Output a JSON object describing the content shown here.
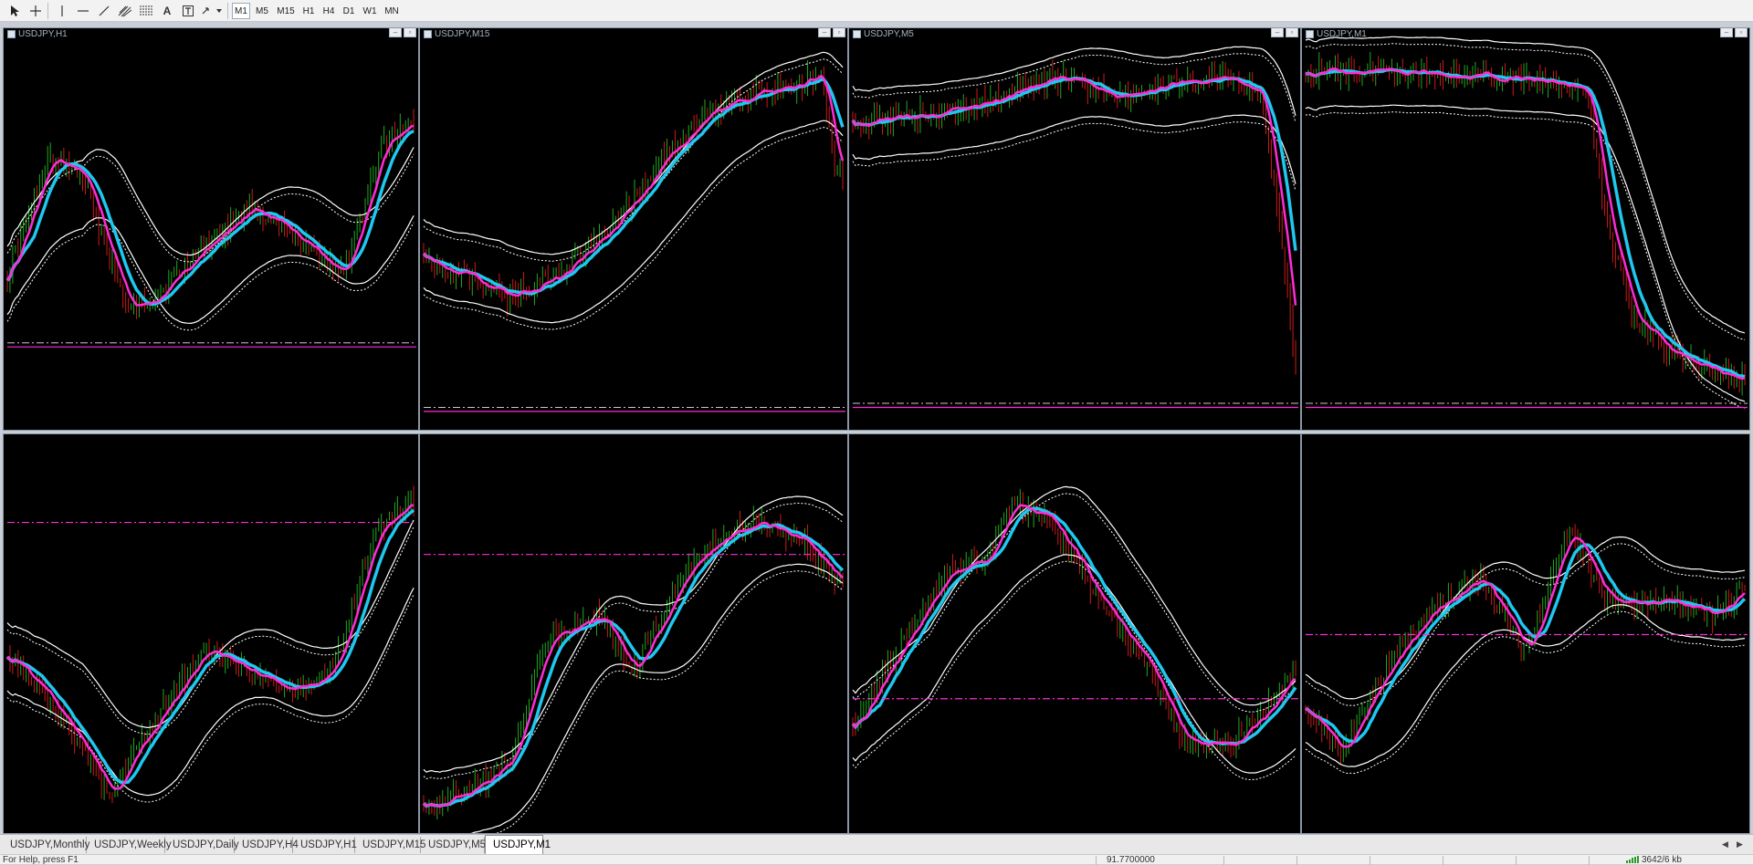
{
  "toolbar": {
    "tools": [
      "cursor-icon",
      "crosshair-icon",
      "vertical-line-icon",
      "horizontal-line-icon",
      "trendline-icon",
      "fibonacci-channel-icon",
      "fibonacci-levels-icon",
      "text-icon",
      "text-label-icon",
      "arrows-dropdown-icon"
    ],
    "timeframes": [
      "M1",
      "M5",
      "M15",
      "H1",
      "H4",
      "D1",
      "W1",
      "MN"
    ],
    "active_timeframe": "M1"
  },
  "windows": [
    {
      "title": "USDJPY,H1",
      "series": 1
    },
    {
      "title": "USDJPY,M15",
      "series": 2
    },
    {
      "title": "USDJPY,M5",
      "series": 3
    },
    {
      "title": "USDJPY,M1",
      "series": 4
    },
    {
      "title": "",
      "series": 5
    },
    {
      "title": "",
      "series": 6
    },
    {
      "title": "",
      "series": 7
    },
    {
      "title": "",
      "series": 8
    }
  ],
  "colors": {
    "background": "#000000",
    "bull_candle": "#1faa1f",
    "bear_candle": "#cc1a1a",
    "ma_fast": "#ff2bd6",
    "ma_slow": "#1ec8f0",
    "envelope": "#ffffff",
    "level_gray": "#c8c8c8",
    "level_magenta": "#ff2bd6"
  },
  "tabs": [
    "USDJPY,Monthly",
    "USDJPY,Weekly",
    "USDJPY,Daily",
    "USDJPY,H4",
    "USDJPY,H1",
    "USDJPY,M15",
    "USDJPY,M5",
    "USDJPY,M1"
  ],
  "active_tab": "USDJPY,M1",
  "status": {
    "help": "For Help, press F1",
    "price": "91.7700000",
    "traffic": "3642/6 kb"
  }
}
